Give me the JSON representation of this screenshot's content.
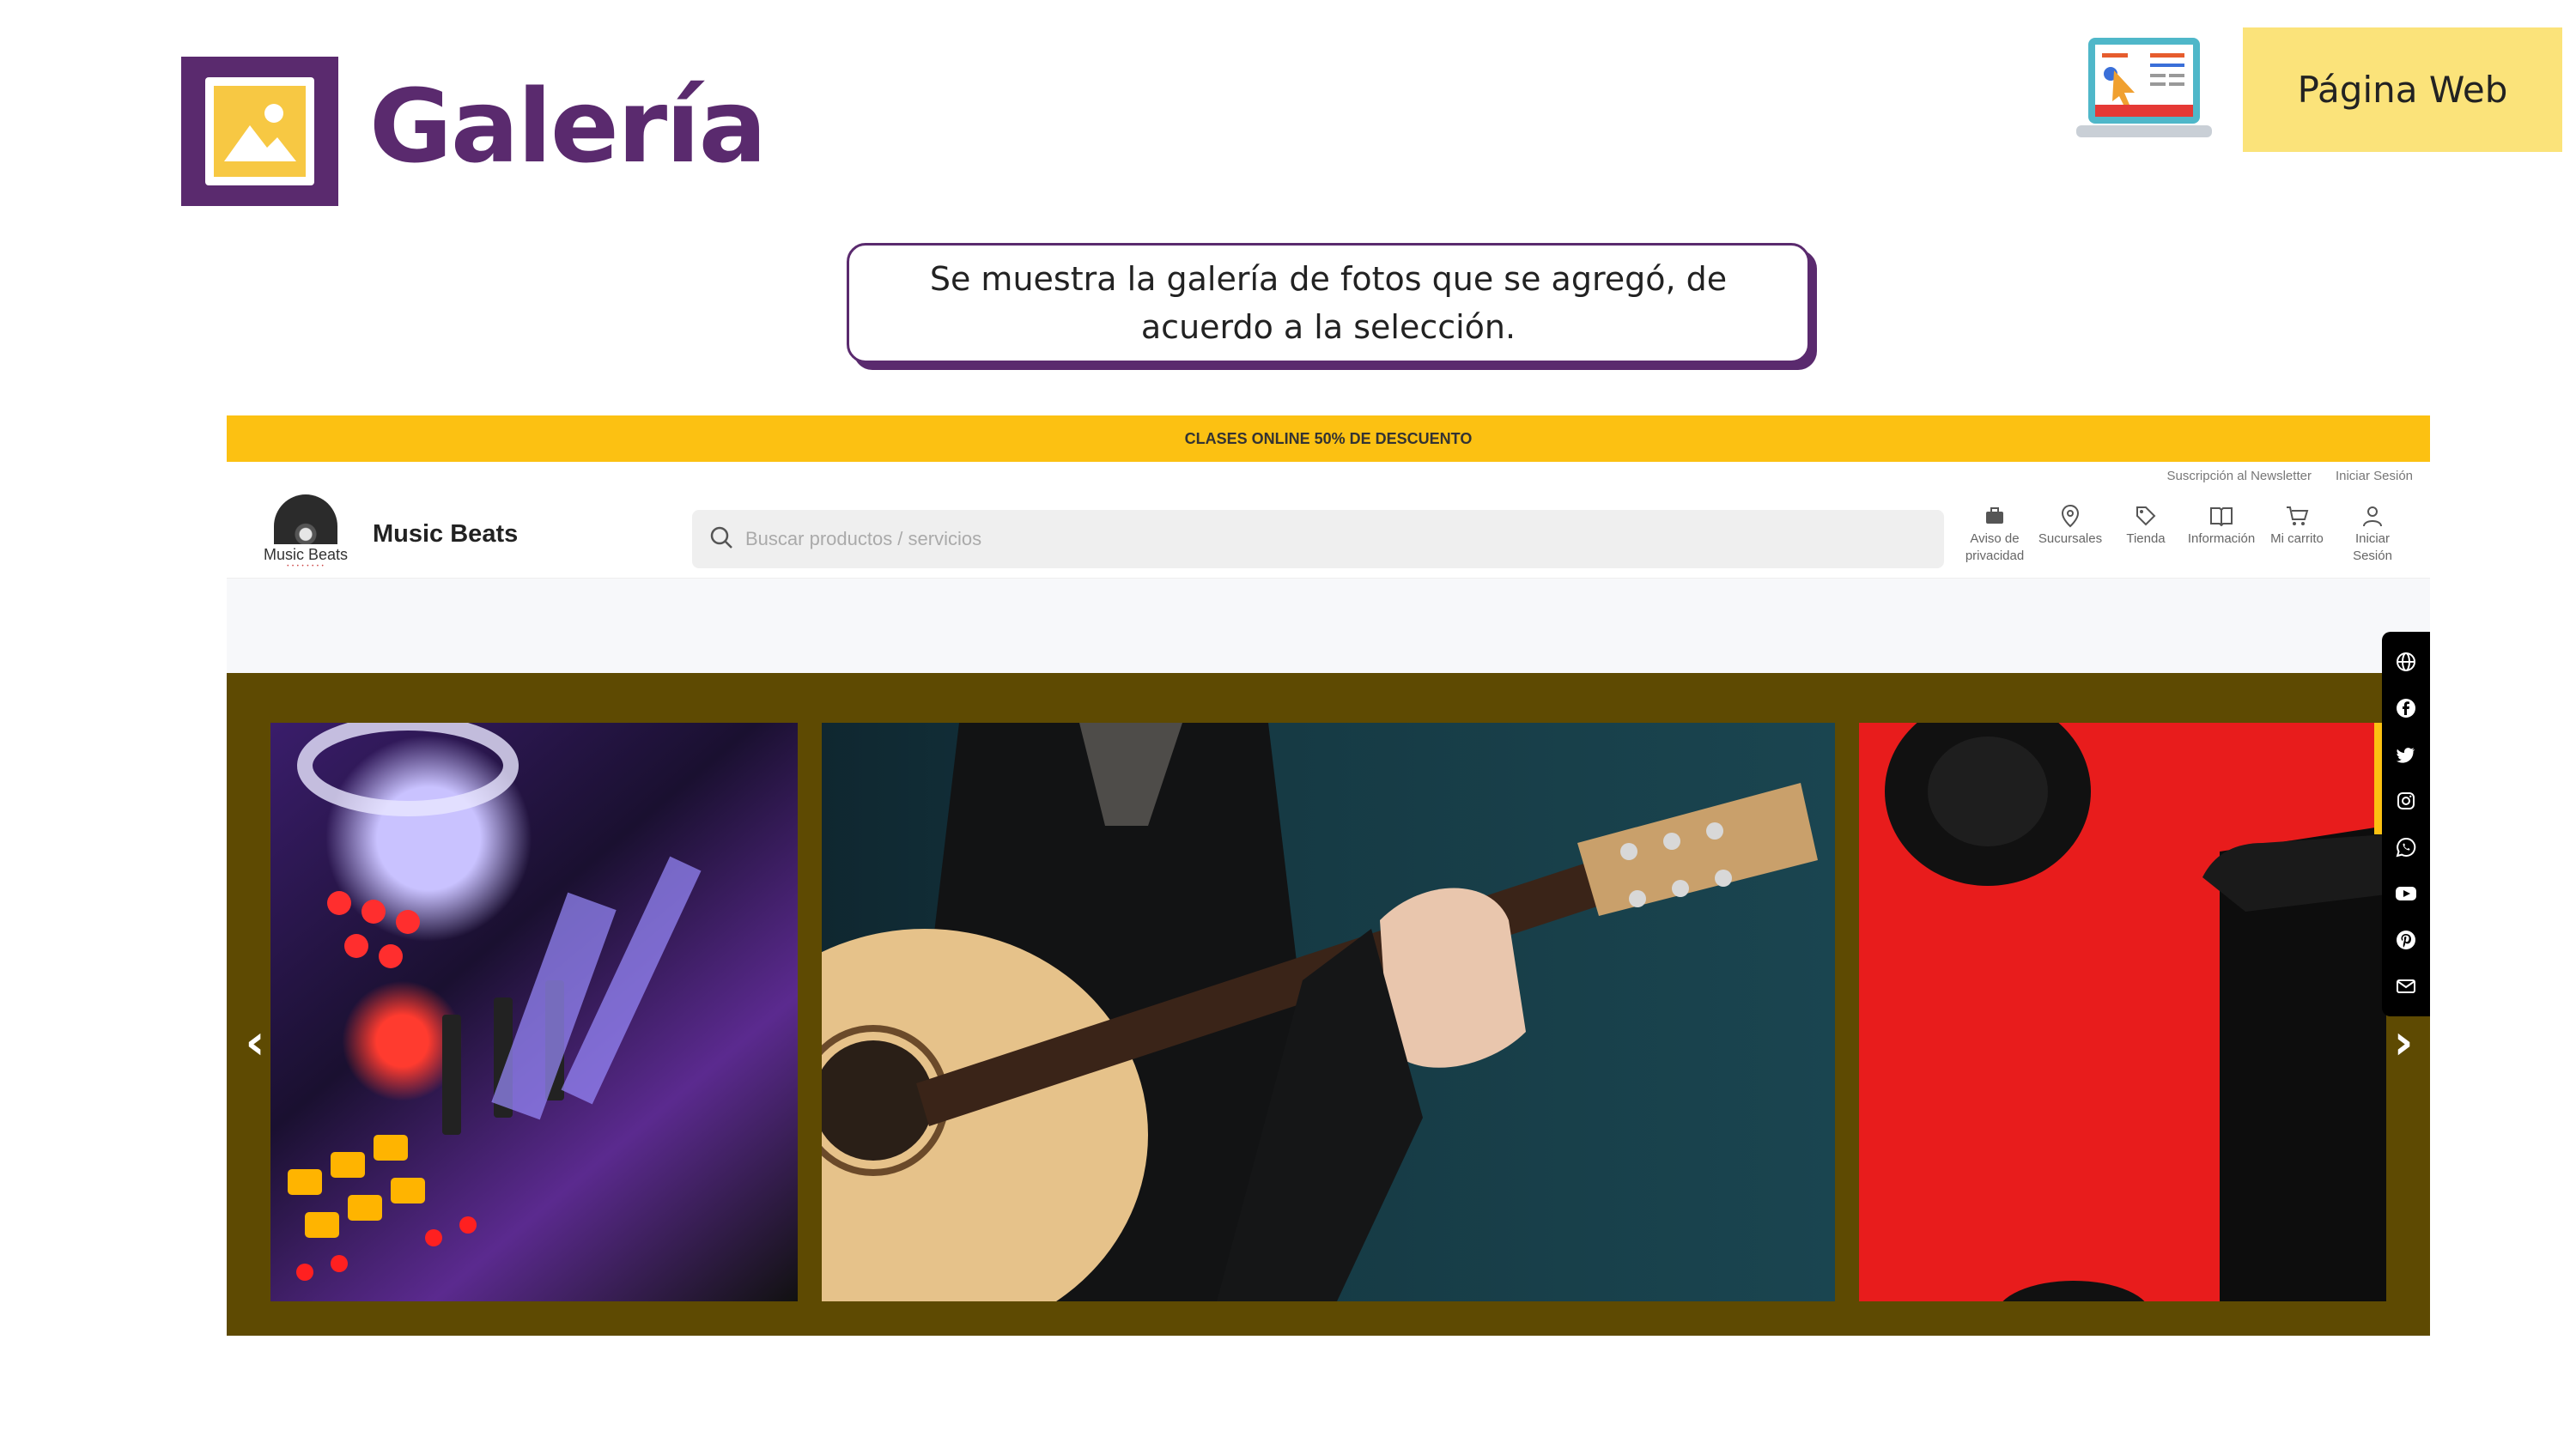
{
  "slide": {
    "title": "Galería",
    "badge": "Página Web",
    "callout": "Se muestra la galería de fotos que se agregó, de acuerdo a la selección.",
    "colors": {
      "brand_purple": "#5a2a6e",
      "badge_yellow": "#fbe37a"
    }
  },
  "site": {
    "promo_banner": "CLASES ONLINE 50% DE DESCUENTO",
    "top_links": [
      "Suscripción al Newsletter",
      "Iniciar Sesión"
    ],
    "logo_text": "Music Beats",
    "brand_name": "Music Beats",
    "search_placeholder": "Buscar productos / servicios",
    "nav": [
      {
        "label": "Aviso de privacidad",
        "icon": "briefcase-icon"
      },
      {
        "label": "Sucursales",
        "icon": "location-pin-icon"
      },
      {
        "label": "Tienda",
        "icon": "tag-icon"
      },
      {
        "label": "Información",
        "icon": "book-icon"
      },
      {
        "label": "Mi carrito",
        "icon": "cart-icon"
      },
      {
        "label": "Iniciar Sesión",
        "icon": "user-icon"
      }
    ],
    "gallery": {
      "photos": [
        "dj-mixer-photo",
        "acoustic-guitar-photo",
        "headphones-phone-photo"
      ],
      "colors": {
        "background": "#5e4a02",
        "promo": "#fcc112"
      }
    },
    "social_icons": [
      "globe-icon",
      "facebook-icon",
      "twitter-icon",
      "instagram-icon",
      "whatsapp-icon",
      "youtube-icon",
      "pinterest-icon",
      "mail-icon"
    ]
  }
}
